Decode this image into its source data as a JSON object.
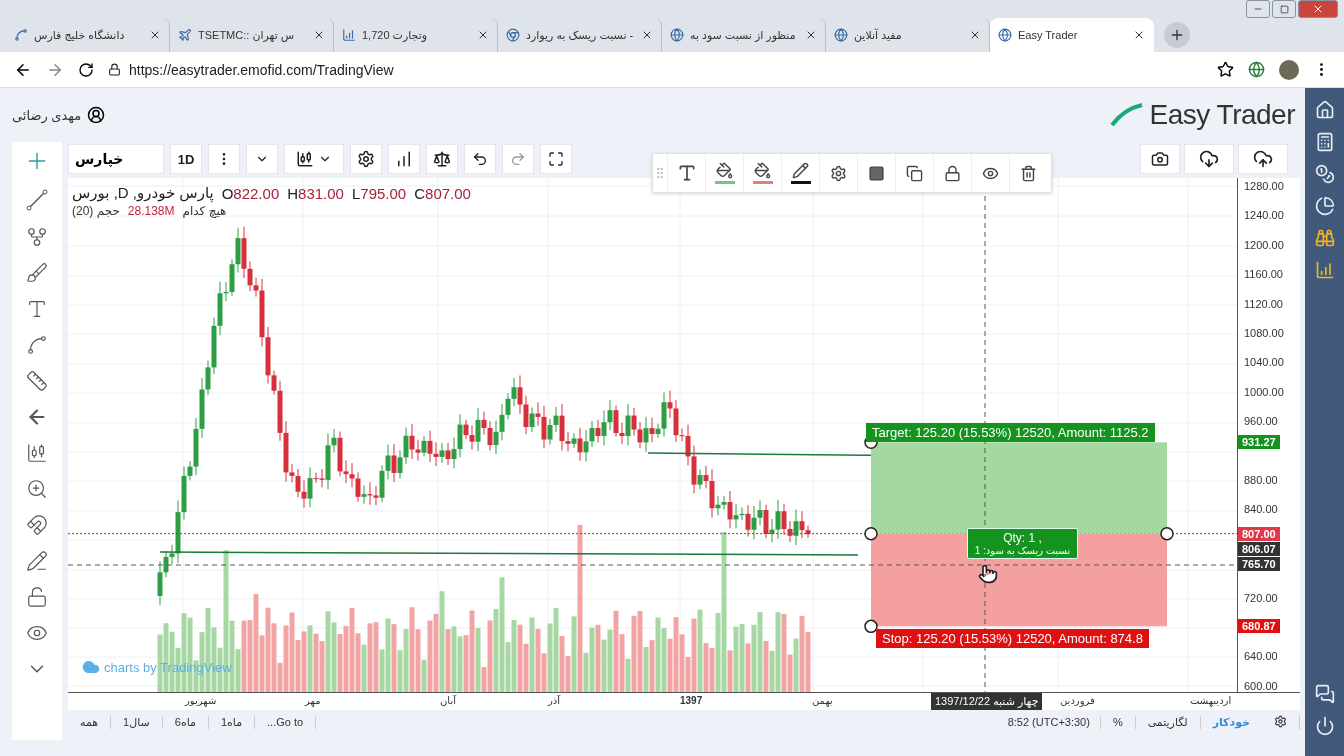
{
  "browser": {
    "tabs": [
      {
        "title": "Easy Trader",
        "selected": true
      },
      {
        "title": "مفید آنلاین",
        "selected": false
      },
      {
        "title": "منظور از نسبت سود به",
        "selected": false
      },
      {
        "title": "نسبت ریسک به ریوارد -",
        "selected": false
      },
      {
        "title": "وتجارت 1,720",
        "selected": false
      },
      {
        "title": "TSETMC:: س تهران",
        "selected": false
      },
      {
        "title": "دانشگاه خلیج فارس",
        "selected": false
      }
    ],
    "url": "https://easytrader.emofid.com/TradingView"
  },
  "header": {
    "user": "مهدی رضائی",
    "logo": "Easy Trader"
  },
  "toolbar": {
    "symbol": "خپارس",
    "interval": "1D"
  },
  "legend": {
    "title": "پارس خودرو, D, بورس",
    "ohlc": [
      "C807.00",
      "L795.00",
      "H831.00",
      "O822.00"
    ],
    "volume_title": "حجم (20)",
    "volume_value": "28.138M",
    "volume_note": "هیچ کدام"
  },
  "price_axis": {
    "ticks": [
      "1280.00",
      "1240.00",
      "1200.00",
      "1160.00",
      "1120.00",
      "1080.00",
      "1040.00",
      "1000.00",
      "960.00",
      "880.00",
      "840.00",
      "720.00",
      "640.00",
      "600.00"
    ],
    "markers": [
      {
        "value": "931.27",
        "color": "#14931f"
      },
      {
        "value": "807.00",
        "color": "#e0394b"
      },
      {
        "value": "806.07",
        "color": "#333333"
      },
      {
        "value": "765.70",
        "color": "#333333"
      },
      {
        "value": "680.87",
        "color": "#e01010"
      }
    ]
  },
  "position": {
    "target": "Target: 125.20 (15.53%) 12520, Amount: 1125.2",
    "stop": "Stop: 125.20 (15.53%) 12520, Amount: 874.8",
    "qty": "Qty: 1 ,",
    "ratio": "نسبت ریسک به سود: 1"
  },
  "attribution": "charts by TradingView",
  "time_axis": {
    "labels": [
      {
        "text": "اردیبهشت",
        "kind": "month"
      },
      {
        "text": "فروردین",
        "kind": "month"
      },
      {
        "text": "بهمن",
        "kind": "month"
      },
      {
        "text": "1397",
        "kind": "year"
      },
      {
        "text": "آذر",
        "kind": "month"
      },
      {
        "text": "آبان",
        "kind": "month"
      },
      {
        "text": "مهر",
        "kind": "month"
      },
      {
        "text": "شهریور",
        "kind": "month"
      }
    ],
    "crosshair_date": "1397/12/22 چهار شنبه"
  },
  "bottom_bar": {
    "ranges": [
      "...Go to",
      "1ماه",
      "6ماه",
      "1سال",
      "همه"
    ],
    "time": "8:52 (UTC+3:30)",
    "scales": [
      {
        "label": "خودکار",
        "selected": true
      },
      {
        "label": "لگاریتمی",
        "selected": false
      },
      {
        "label": "%",
        "selected": false
      }
    ]
  }
}
